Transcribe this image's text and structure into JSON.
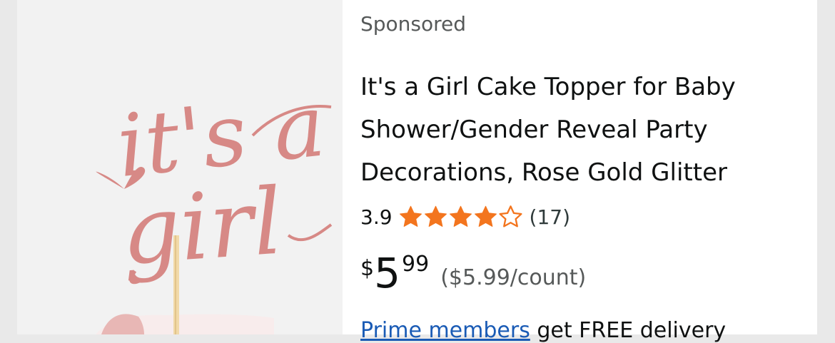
{
  "product": {
    "image_alt": "It's a Girl rose gold glitter cake topper",
    "topper_text": [
      "it's a",
      "girl"
    ],
    "sponsored_label": "Sponsored",
    "title_lines": [
      "It's a Girl Cake Topper for Baby",
      "Shower/Gender Reveal Party",
      "Decorations, Rose Gold Glitter"
    ],
    "rating": {
      "value": "3.9",
      "stars": 3.9,
      "stars_out_of": 5,
      "count": "(17)"
    },
    "price": {
      "symbol": "$",
      "whole": "5",
      "fraction": "99",
      "unit_price": "($5.99/count)"
    },
    "delivery": {
      "prime_link": "Prime members",
      "text": "get FREE delivery"
    }
  },
  "colors": {
    "star": "#f3751e",
    "link": "#1a5bb5",
    "topper": "#d78986",
    "image_background": "#f2f2f2"
  },
  "icons": [
    "star-filled-icon",
    "star-empty-icon"
  ]
}
